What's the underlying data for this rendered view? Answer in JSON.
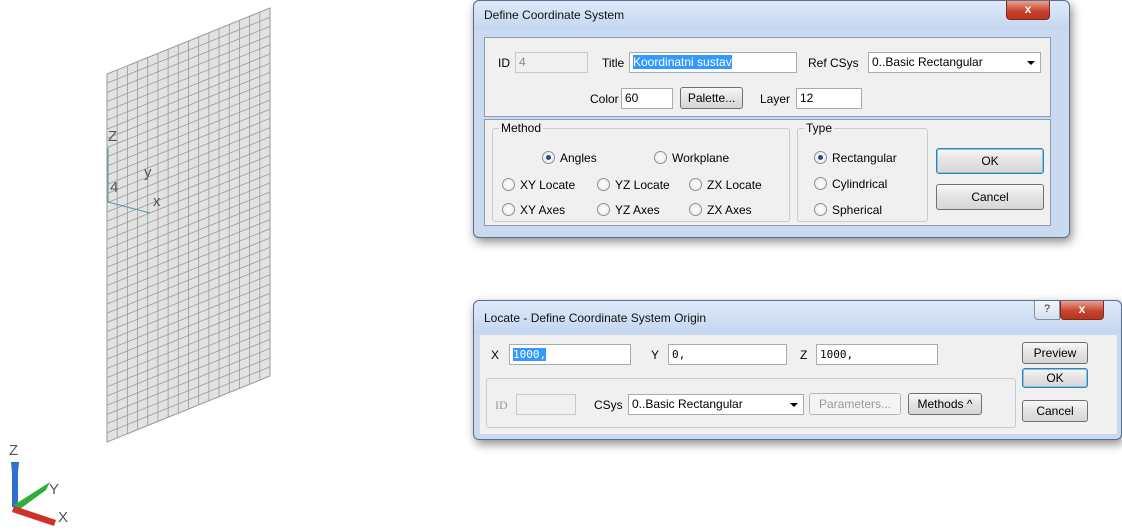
{
  "viewport": {
    "csys_id_label": "4",
    "csys_axis_z": "Z",
    "csys_axis_y": "y",
    "csys_axis_x": "x",
    "triad_z": "Z",
    "triad_y": "Y",
    "triad_x": "X",
    "colors": {
      "mesh_fill": "#e2e2e2",
      "mesh_line": "#9a9a9a",
      "triad_z": "#2f6fd0",
      "triad_y": "#2fae3a",
      "triad_x": "#d0302a"
    }
  },
  "define_csys": {
    "title": "Define Coordinate System",
    "close_label": "x",
    "id_label": "ID",
    "id_value": "4",
    "title_label": "Title",
    "title_value": "Koordinatni sustav",
    "refcsys_label": "Ref CSys",
    "refcsys_value": "0..Basic Rectangular",
    "color_label": "Color",
    "color_value": "60",
    "palette_label": "Palette...",
    "layer_label": "Layer",
    "layer_value": "12",
    "method": {
      "legend": "Method",
      "options": [
        "Angles",
        "Workplane",
        "XY Locate",
        "YZ Locate",
        "ZX Locate",
        "XY Axes",
        "YZ Axes",
        "ZX Axes"
      ],
      "selected": "Angles"
    },
    "type": {
      "legend": "Type",
      "options": [
        "Rectangular",
        "Cylindrical",
        "Spherical"
      ],
      "selected": "Rectangular"
    },
    "ok_label": "OK",
    "cancel_label": "Cancel"
  },
  "locate_origin": {
    "title": "Locate - Define Coordinate System Origin",
    "help_label": "?",
    "close_label": "x",
    "x_label": "X",
    "x_value": "1000,",
    "y_label": "Y",
    "y_value": "0,",
    "z_label": "Z",
    "z_value": "1000,",
    "preview_label": "Preview",
    "ok_label": "OK",
    "cancel_label": "Cancel",
    "id_label": "ID",
    "id_value": "",
    "csys_label": "CSys",
    "csys_value": "0..Basic Rectangular",
    "parameters_label": "Parameters...",
    "methods_label": "Methods ^"
  }
}
